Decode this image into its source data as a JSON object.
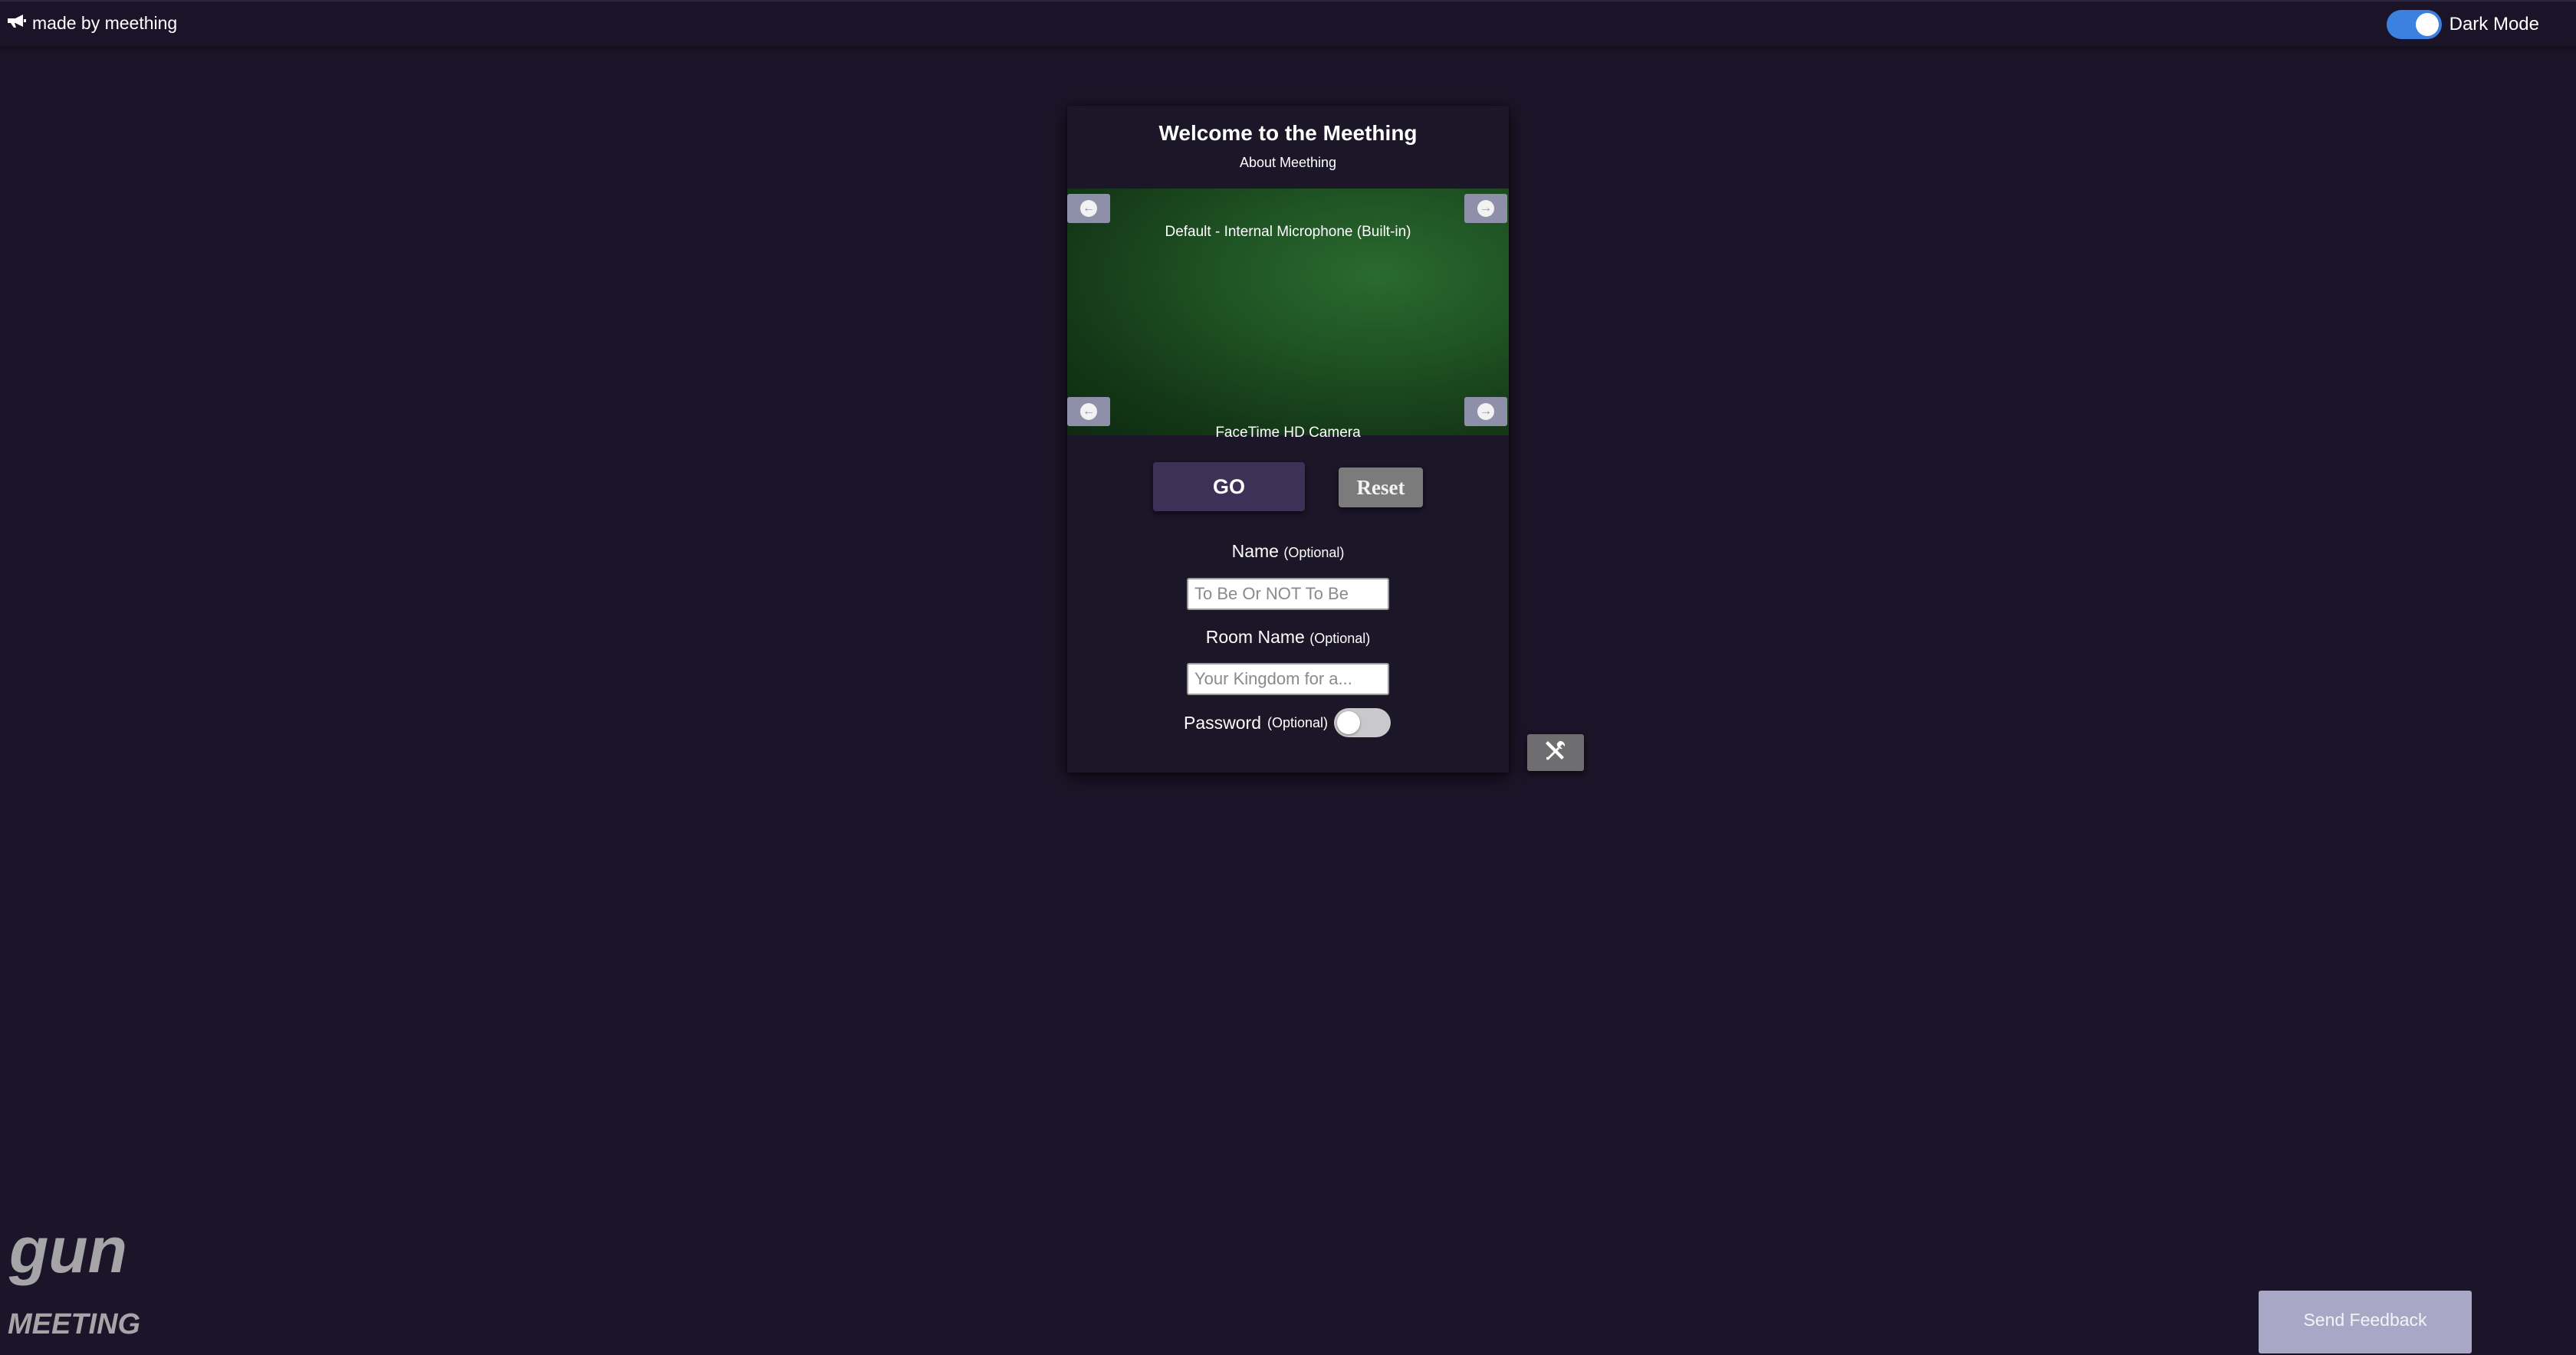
{
  "topbar": {
    "made_by_label": "made by meething",
    "made_by_icon": "megaphone-icon",
    "dark_mode_label": "Dark Mode",
    "dark_mode_on": true
  },
  "card": {
    "title": "Welcome to the Meething",
    "subtitle": "About Meething",
    "mic_label": "Default - Internal Microphone (Built-in)",
    "camera_label": "FaceTime HD Camera",
    "nav_icons": {
      "prev": "arrow-left-circle-icon",
      "next": "arrow-right-circle-icon"
    }
  },
  "actions": {
    "go_label": "GO",
    "reset_label": "Reset"
  },
  "form": {
    "name_label": "Name",
    "name_optional": "(Optional)",
    "name_placeholder": "To Be Or NOT To Be",
    "room_label": "Room Name",
    "room_optional": "(Optional)",
    "room_placeholder": "Your Kingdom for a...",
    "password_label": "Password",
    "password_optional": "(Optional)",
    "password_enabled": false
  },
  "tools": {
    "icon": "tools-icon"
  },
  "logo": {
    "text_top": "gun",
    "text_bottom": "MEETING"
  },
  "feedback": {
    "label": "Send Feedback"
  },
  "colors": {
    "background": "#1c1529",
    "go_button": "#3e3158",
    "reset_button": "#7b7b7b",
    "toggle_on": "#3b82e0",
    "feedback_button": "#a9a7c6",
    "preview_green": "#1f5424"
  }
}
